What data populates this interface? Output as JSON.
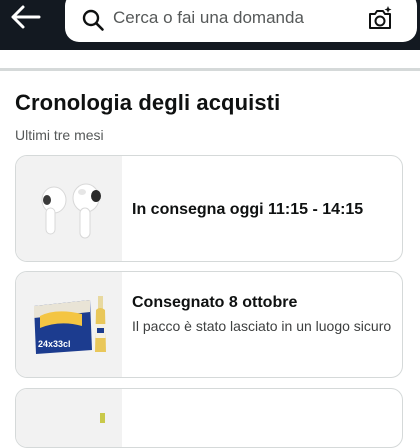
{
  "search": {
    "placeholder": "Cerca o fai una domanda"
  },
  "page": {
    "title": "Cronologia degli acquisti",
    "subtitle": "Ultimi tre mesi"
  },
  "orders": [
    {
      "status": "In consegna oggi 11:15 - 14:15",
      "detail": "",
      "image": "wireless-earbuds"
    },
    {
      "status": "Consegnato 8 ottobre",
      "detail": "Il pacco è stato lasciato in un luogo sicuro",
      "image": "beer-pack"
    }
  ],
  "thumbnail_labels": {
    "pack_count": "24x33cl"
  }
}
